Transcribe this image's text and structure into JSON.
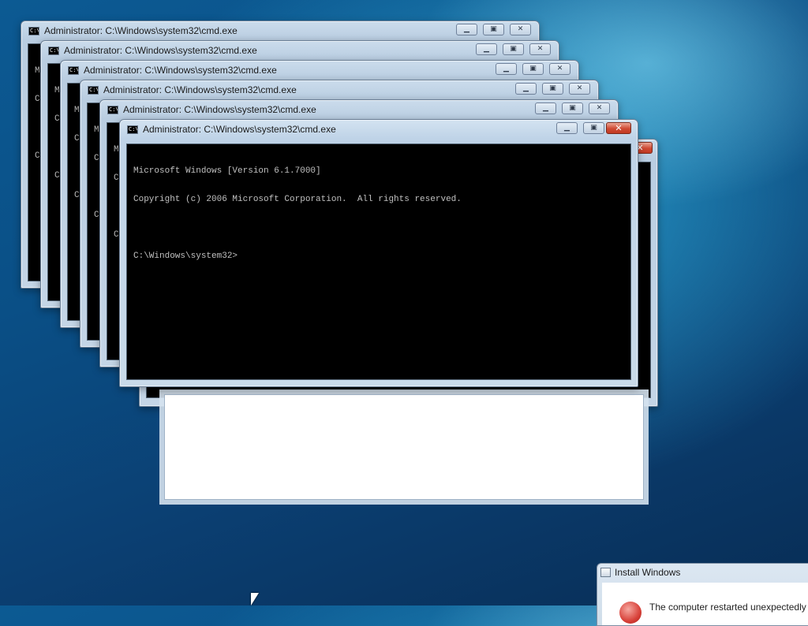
{
  "windows": [
    {
      "title": "Administrator: C:\\Windows\\system32\\cmd.exe",
      "lines": [
        "Mi",
        "Co",
        "",
        "C:"
      ]
    },
    {
      "title": "Administrator: C:\\Windows\\system32\\cmd.exe",
      "lines": [
        "Mi",
        "Co",
        "",
        "C:"
      ]
    },
    {
      "title": "Administrator: C:\\Windows\\system32\\cmd.exe",
      "lines": [
        "Mi",
        "Co",
        "",
        "C:"
      ]
    },
    {
      "title": "Administrator: C:\\Windows\\system32\\cmd.exe",
      "lines": [
        "Mi",
        "Co",
        "",
        "C:"
      ]
    },
    {
      "title": "Administrator: C:\\Windows\\system32\\cmd.exe",
      "lines": [
        "Mi",
        "Co",
        "",
        "C:"
      ]
    },
    {
      "title": "Administrator: C:\\Windows\\system32\\cmd.exe",
      "lines": [
        "Microsoft Windows [Version 6.1.7000]",
        "Copyright (c) 2006 Microsoft Corporation.  All rights reserved.",
        "",
        "C:\\Windows\\system32>"
      ]
    }
  ],
  "icon_text": "C:\\",
  "caption_buttons": {
    "minimize": "▁",
    "maximize": "▣",
    "close": "✕"
  },
  "install_dialog": {
    "title": "Install Windows",
    "message": "The computer restarted unexpectedly"
  },
  "colors": {
    "console_bg": "#000000",
    "console_text": "#c0c0c0",
    "close_red": "#c23a22"
  }
}
